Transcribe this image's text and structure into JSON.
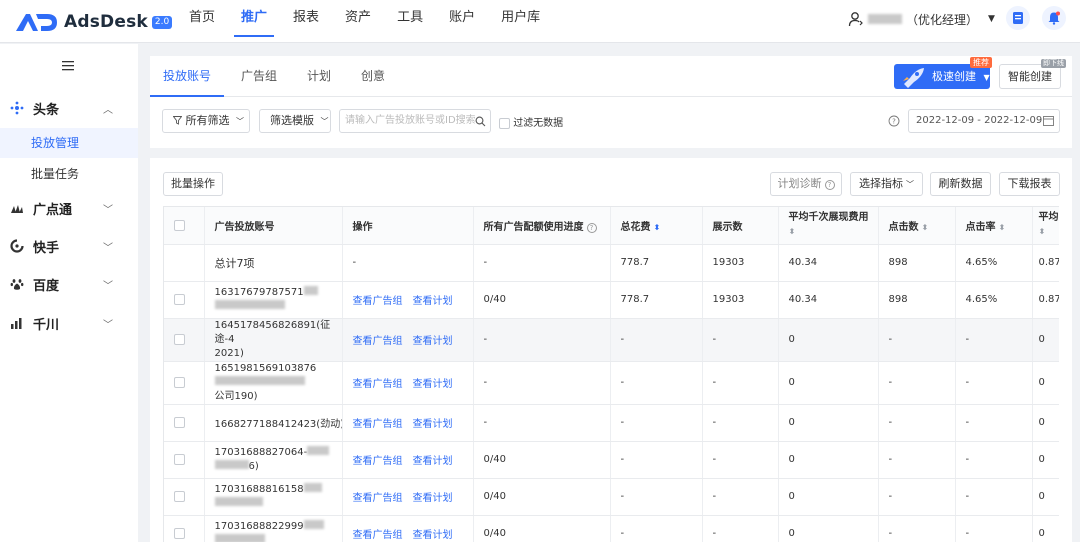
{
  "app": {
    "name": "AdsDesk",
    "badge": "2.0"
  },
  "topnav": {
    "items": [
      "首页",
      "推广",
      "报表",
      "资产",
      "工具",
      "账户",
      "用户库"
    ],
    "active": "推广"
  },
  "user": {
    "role": "（优化经理）"
  },
  "sidebar": {
    "groups": [
      {
        "label": "头条",
        "expanded": true,
        "children": [
          {
            "label": "投放管理",
            "active": true
          },
          {
            "label": "批量任务",
            "active": false
          }
        ]
      },
      {
        "label": "广点通",
        "expanded": false
      },
      {
        "label": "快手",
        "expanded": false
      },
      {
        "label": "百度",
        "expanded": false
      },
      {
        "label": "千川",
        "expanded": false
      }
    ]
  },
  "tabs": {
    "items": [
      "投放账号",
      "广告组",
      "计划",
      "创意"
    ],
    "active": "投放账号"
  },
  "create": {
    "fast_label": "极速创建",
    "fast_tag": "推荐",
    "smart_label": "智能创建",
    "smart_tag": "即下线"
  },
  "filters": {
    "all_filter": "所有筛选",
    "template": "筛选模版",
    "search_placeholder": "请输入广告投放账号或ID搜索",
    "filter_empty": "过滤无数据",
    "date_range": "2022-12-09 - 2022-12-09"
  },
  "toolbar": {
    "batch": "批量操作",
    "diagnose": "计划诊断",
    "choose_metrics": "选择指标",
    "refresh": "刷新数据",
    "download": "下载报表"
  },
  "table": {
    "headers": [
      "广告投放账号",
      "操作",
      "所有广告配额使用进度",
      "总花费",
      "展示数",
      "平均千次展现费用",
      "点击数",
      "点击率",
      "平均"
    ],
    "link_group": "查看广告组",
    "link_plan": "查看计划",
    "total_row": {
      "account": "总计7项",
      "op": "-",
      "quota": "-",
      "cost": "778.7",
      "shows": "19303",
      "cpm": "40.34",
      "clicks": "898",
      "ctr": "4.65%",
      "avg": "0.87"
    },
    "rows": [
      {
        "account_line1": "16317679787571",
        "account_line2": "",
        "quota": "0/40",
        "cost": "778.7",
        "shows": "19303",
        "cpm": "40.34",
        "clicks": "898",
        "ctr": "4.65%",
        "avg": "0.87"
      },
      {
        "account_line1": "1645178456826891(征途-4",
        "account_line2": "2021)",
        "quota": "-",
        "cost": "-",
        "shows": "-",
        "cpm": "0",
        "clicks": "-",
        "ctr": "-",
        "avg": "0"
      },
      {
        "account_line1": "1651981569103876",
        "account_line2": "公司190)",
        "quota": "-",
        "cost": "-",
        "shows": "-",
        "cpm": "0",
        "clicks": "-",
        "ctr": "-",
        "avg": "0"
      },
      {
        "account_line1": "1668277188412423(劲动)",
        "account_line2": "",
        "quota": "-",
        "cost": "-",
        "shows": "-",
        "cpm": "0",
        "clicks": "-",
        "ctr": "-",
        "avg": "0"
      },
      {
        "account_line1": "17031688827064-",
        "account_line2": "6)",
        "quota": "0/40",
        "cost": "-",
        "shows": "-",
        "cpm": "0",
        "clicks": "-",
        "ctr": "-",
        "avg": "0"
      },
      {
        "account_line1": "17031688816158",
        "account_line2": "",
        "quota": "0/40",
        "cost": "-",
        "shows": "-",
        "cpm": "0",
        "clicks": "-",
        "ctr": "-",
        "avg": "0"
      },
      {
        "account_line1": "17031688822999",
        "account_line2": "",
        "quota": "0/40",
        "cost": "-",
        "shows": "-",
        "cpm": "0",
        "clicks": "-",
        "ctr": "-",
        "avg": "0"
      }
    ]
  },
  "colors": {
    "accent": "#2f6cf6",
    "highlight_row": "#f5f6f8"
  }
}
